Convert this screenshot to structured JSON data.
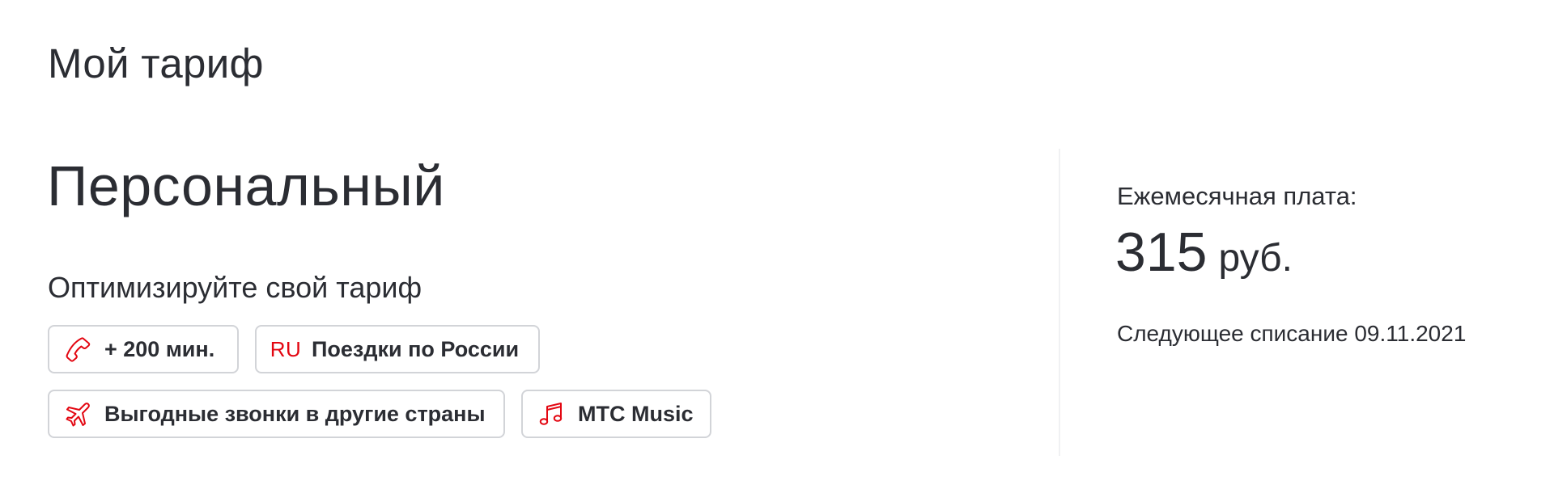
{
  "section_title": "Мой тариф",
  "tariff": {
    "name": "Персональный",
    "optimize_label": "Оптимизируйте свой тариф"
  },
  "options": [
    {
      "label": "+ 200 мин.",
      "icon": "phone-icon"
    },
    {
      "label": "Поездки по России",
      "icon": "ru-icon",
      "icon_text": "RU"
    },
    {
      "label": "Выгодные звонки в другие страны",
      "icon": "airplane-icon"
    },
    {
      "label": "МТС Music",
      "icon": "music-note-icon"
    }
  ],
  "billing": {
    "fee_label": "Ежемесячная плата:",
    "amount": "315",
    "currency": "руб.",
    "next_charge": "Следующее списание 09.11.2021"
  },
  "colors": {
    "accent": "#e30611",
    "text": "#2b2d33",
    "chip_border": "#d2d4d8",
    "divider": "#f0f1f3"
  }
}
